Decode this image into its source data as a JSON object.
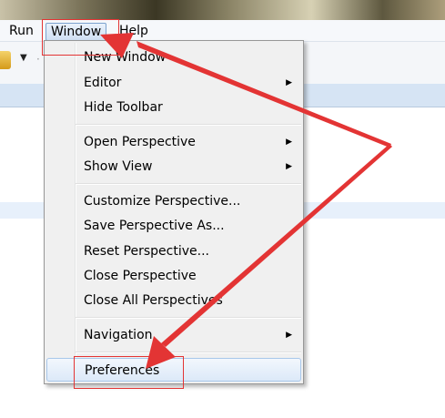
{
  "menubar": {
    "items": [
      "Run",
      "Window",
      "Help"
    ],
    "active_item": "Window"
  },
  "toolbar": {
    "dropdown_glyph": "▼",
    "separator_glyph": "·"
  },
  "window_menu": {
    "items": [
      {
        "label": "New Window",
        "submenu": false
      },
      {
        "label": "Editor",
        "submenu": true
      },
      {
        "label": "Hide Toolbar",
        "submenu": false
      },
      {
        "label": "Open Perspective",
        "submenu": true
      },
      {
        "label": "Show View",
        "submenu": true
      },
      {
        "label": "Customize Perspective...",
        "submenu": false
      },
      {
        "label": "Save Perspective As...",
        "submenu": false
      },
      {
        "label": "Reset Perspective...",
        "submenu": false
      },
      {
        "label": "Close Perspective",
        "submenu": false
      },
      {
        "label": "Close All Perspectives",
        "submenu": false
      },
      {
        "label": "Navigation",
        "submenu": true
      },
      {
        "label": "Preferences",
        "submenu": false
      }
    ],
    "submenu_arrow": "▶",
    "highlighted_item": "Preferences"
  },
  "annotations": {
    "color": "#e33434",
    "targets": [
      "Window",
      "Preferences"
    ]
  }
}
